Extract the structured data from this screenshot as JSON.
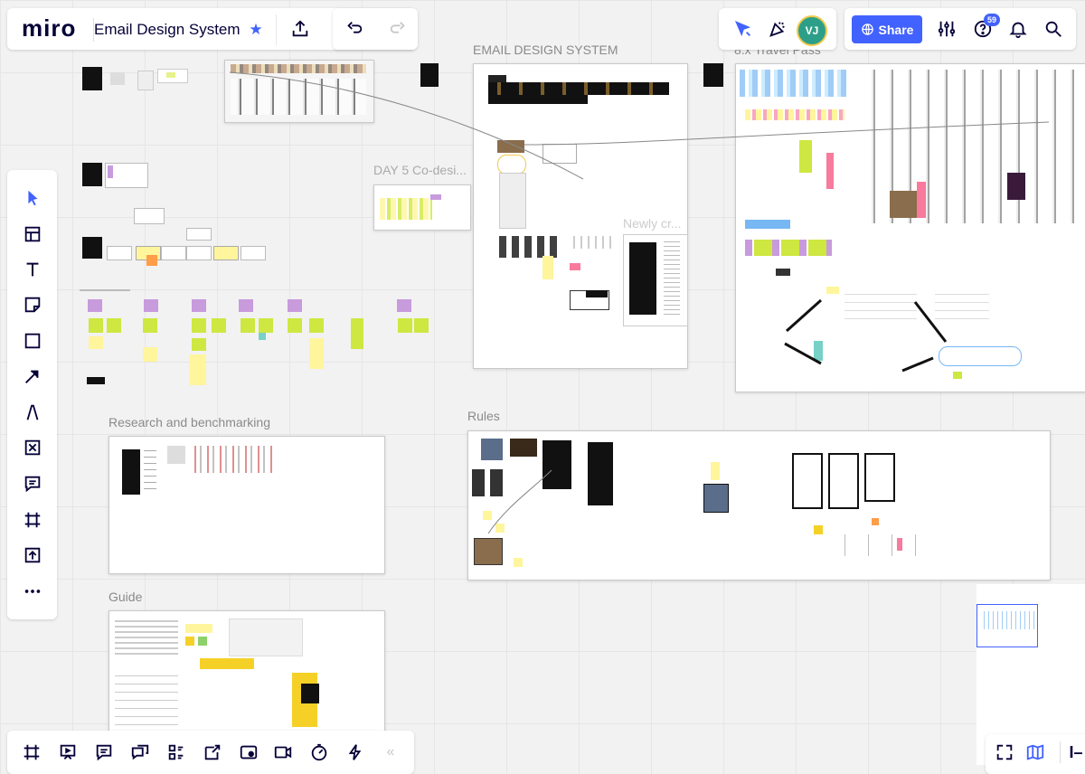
{
  "app": {
    "logo": "miro",
    "board_title": "Email Design System"
  },
  "header_right": {
    "avatar_initials": "VJ",
    "share_label": "Share",
    "help_badge": "59"
  },
  "frames": {
    "email_design_system": "EMAIL DESIGN SYSTEM",
    "travel_pass": "8.x Travel Pass",
    "day5": "DAY 5 Co-desi...",
    "newly_created": "Newly cr...",
    "research": "Research and benchmarking",
    "rules": "Rules",
    "guide": "Guide"
  },
  "icons": {
    "left_toolbar": [
      "select-icon",
      "templates-icon",
      "text-icon",
      "sticky-note-icon",
      "shape-icon",
      "arrow-icon",
      "pen-icon",
      "frame-icon",
      "comment-icon",
      "crop-frame-icon",
      "upload-icon",
      "more-icon"
    ],
    "bottom_toolbar": [
      "frames-icon",
      "presentation-icon",
      "comments-icon",
      "chat-icon",
      "cards-icon",
      "share-screen-icon",
      "screen-record-icon",
      "video-call-icon",
      "timer-icon",
      "activity-icon",
      "collapse-icon"
    ]
  },
  "colors": {
    "accent": "#4262ff",
    "sticky_yellow": "#fff59c",
    "sticky_purple": "#c79bdc",
    "sticky_green": "#cee741"
  }
}
